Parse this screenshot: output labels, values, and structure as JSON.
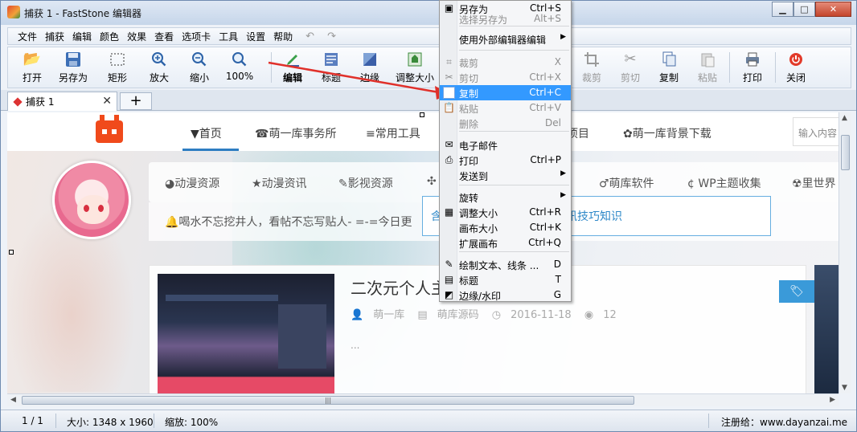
{
  "window": {
    "title": "捕获 1 - FastStone 编辑器",
    "controls": [
      "▁",
      "□",
      "✕"
    ]
  },
  "menubar": {
    "items": [
      "文件",
      "捕获",
      "编辑",
      "颜色",
      "效果",
      "查看",
      "选项卡",
      "工具",
      "设置",
      "帮助"
    ],
    "undo": "↶",
    "redo": "↷"
  },
  "toolbar": {
    "open": "打开",
    "save_as": "另存为",
    "rect": "矩形",
    "zoom_in": "放大",
    "zoom_out": "缩小",
    "zoom_level": "100%",
    "edit": "编辑",
    "caption": "标题",
    "edge": "边缘",
    "resize": "调整大小",
    "crop": "裁剪",
    "cut": "剪切",
    "copy": "复制",
    "paste": "粘贴",
    "print": "打印",
    "close": "关闭"
  },
  "tabs": {
    "active": "捕获 1",
    "close": "✕",
    "new": "+"
  },
  "website": {
    "nav": [
      "▼首页",
      "☎萌一库事务所",
      "≡常用工具",
      "项目",
      "✿萌一库背景下载"
    ],
    "search_placeholder": "输入内容",
    "categories": [
      "◕动漫资源",
      "★动漫资讯",
      "✎影视资源",
      "✣",
      "♂萌库软件",
      "¢ WP主题收集",
      "☢里世界"
    ],
    "notice": "🔔喝水不忘挖井人，看帖不忘写贴人- =-=今日更",
    "notice_box": "含各类与网站相关的资源资讯技巧知识",
    "post": {
      "title": "二次元个人主",
      "author": "萌一库",
      "category": "萌库源码",
      "date": "2016-11-18",
      "views": "12",
      "excerpt": "..."
    }
  },
  "context_menu": {
    "items": [
      {
        "label": "另存为",
        "shortcut": "Ctrl+S",
        "icon": "save-icon",
        "glyph": "▣",
        "disabled": false
      },
      {
        "label": "选择另存为",
        "shortcut": "Alt+S",
        "icon": "",
        "glyph": "",
        "disabled": true
      },
      {
        "label": "使用外部编辑器编辑",
        "shortcut": "",
        "icon": "",
        "glyph": "",
        "disabled": false,
        "submenu": true
      },
      {
        "label": "裁剪",
        "shortcut": "X",
        "icon": "crop-icon",
        "glyph": "⌗",
        "disabled": true
      },
      {
        "label": "剪切",
        "shortcut": "Ctrl+X",
        "icon": "scissors-icon",
        "glyph": "✂",
        "disabled": true
      },
      {
        "label": "复制",
        "shortcut": "Ctrl+C",
        "icon": "copy-icon",
        "glyph": "❐",
        "disabled": false,
        "highlight": true
      },
      {
        "label": "粘贴",
        "shortcut": "Ctrl+V",
        "icon": "paste-icon",
        "glyph": "📋",
        "disabled": true
      },
      {
        "label": "删除",
        "shortcut": "Del",
        "icon": "",
        "glyph": "",
        "disabled": true
      },
      {
        "label": "电子邮件",
        "shortcut": "",
        "icon": "email-icon",
        "glyph": "✉",
        "disabled": false
      },
      {
        "label": "打印",
        "shortcut": "Ctrl+P",
        "icon": "printer-icon",
        "glyph": "⎙",
        "disabled": false
      },
      {
        "label": "发送到",
        "shortcut": "",
        "icon": "",
        "glyph": "",
        "disabled": false,
        "submenu": true
      },
      {
        "label": "旋转",
        "shortcut": "",
        "icon": "",
        "glyph": "",
        "disabled": false,
        "submenu": true
      },
      {
        "label": "调整大小",
        "shortcut": "Ctrl+R",
        "icon": "resize-icon",
        "glyph": "▦",
        "disabled": false
      },
      {
        "label": "画布大小",
        "shortcut": "Ctrl+K",
        "icon": "",
        "glyph": "",
        "disabled": false
      },
      {
        "label": "扩展画布",
        "shortcut": "Ctrl+Q",
        "icon": "",
        "glyph": "",
        "disabled": false
      },
      {
        "label": "绘制文本、线条 ...",
        "shortcut": "D",
        "icon": "draw-icon",
        "glyph": "✎",
        "disabled": false
      },
      {
        "label": "标题",
        "shortcut": "T",
        "icon": "caption-icon",
        "glyph": "▤",
        "disabled": false
      },
      {
        "label": "边缘/水印",
        "shortcut": "G",
        "icon": "edge-icon",
        "glyph": "◩",
        "disabled": false
      }
    ]
  },
  "statusbar": {
    "page": "1 / 1",
    "size": "大小: 1348 x 1960",
    "zoom": "缩放: 100%",
    "registered": "注册给：www.dayanzai.me"
  },
  "colors": {
    "accent": "#3399ff",
    "site_brand": "#f04a1b",
    "arrow": "#e0302a"
  }
}
